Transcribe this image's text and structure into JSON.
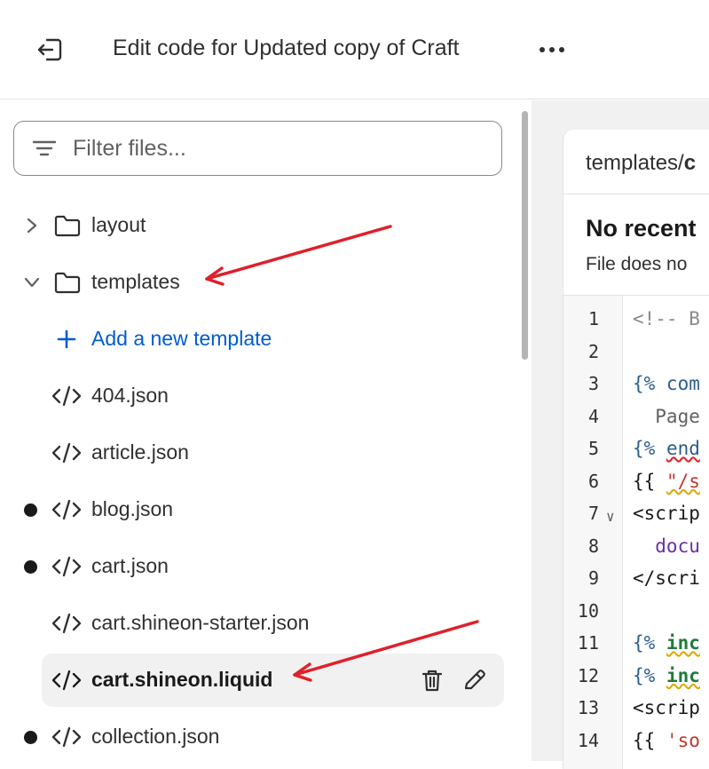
{
  "header": {
    "title": "Edit code for Updated copy of Craft",
    "exit_icon": "exit-icon",
    "more_icon": "more-horizontal-icon"
  },
  "sidebar": {
    "filter": {
      "placeholder": "Filter files...",
      "value": ""
    },
    "items": [
      {
        "type": "folder",
        "label": "layout",
        "expanded": false
      },
      {
        "type": "folder",
        "label": "templates",
        "expanded": true
      },
      {
        "type": "add",
        "label": "Add a new template"
      },
      {
        "type": "file",
        "label": "404.json",
        "modified": false
      },
      {
        "type": "file",
        "label": "article.json",
        "modified": false
      },
      {
        "type": "file",
        "label": "blog.json",
        "modified": true
      },
      {
        "type": "file",
        "label": "cart.json",
        "modified": true
      },
      {
        "type": "file",
        "label": "cart.shineon-starter.json",
        "modified": false
      },
      {
        "type": "file",
        "label": "cart.shineon.liquid",
        "modified": false,
        "selected": true
      },
      {
        "type": "file",
        "label": "collection.json",
        "modified": true
      }
    ]
  },
  "editor": {
    "tab_path_prefix": "templates/",
    "tab_path_file": "c",
    "no_recent_title": "No recent",
    "no_recent_sub": "File does no",
    "code_lines": [
      {
        "n": "1",
        "text": "<!-- B"
      },
      {
        "n": "2",
        "text": ""
      },
      {
        "n": "3",
        "text": "{% com"
      },
      {
        "n": "4",
        "text": "  Page"
      },
      {
        "n": "5",
        "text": "{% end"
      },
      {
        "n": "6",
        "text": "{{ \"/s"
      },
      {
        "n": "7",
        "text": "<scrip"
      },
      {
        "n": "8",
        "text": "  docu"
      },
      {
        "n": "9",
        "text": "</scri"
      },
      {
        "n": "10",
        "text": ""
      },
      {
        "n": "11",
        "text": "{% inc"
      },
      {
        "n": "12",
        "text": "{% inc"
      },
      {
        "n": "13",
        "text": "<scrip"
      },
      {
        "n": "14",
        "text": "{{ 'so"
      }
    ]
  },
  "colors": {
    "accent": "#005bd3",
    "annotation_arrow": "#e0202a",
    "modified_dot": "#1a1a1a"
  }
}
